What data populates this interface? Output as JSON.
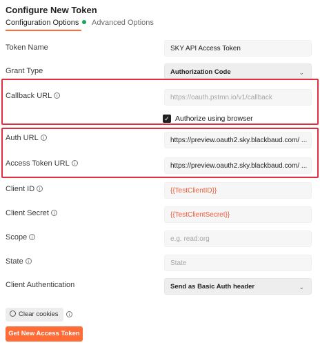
{
  "header": {
    "title": "Configure New Token"
  },
  "tabs": [
    {
      "label": "Configuration Options",
      "active": true,
      "status": "configured"
    },
    {
      "label": "Advanced Options",
      "active": false
    }
  ],
  "fields": {
    "token_name": {
      "label": "Token Name",
      "value": "SKY API Access Token"
    },
    "grant_type": {
      "label": "Grant Type",
      "value": "Authorization Code"
    },
    "callback_url": {
      "label": "Callback URL",
      "placeholder": "https://oauth.pstmn.io/v1/callback"
    },
    "authorize_browser": {
      "label": "Authorize using browser",
      "checked": true
    },
    "auth_url": {
      "label": "Auth URL",
      "value": "https://preview.oauth2.sky.blackbaud.com/ ..."
    },
    "access_token_url": {
      "label": "Access Token URL",
      "value": "https://preview.oauth2.sky.blackbaud.com/ ..."
    },
    "client_id": {
      "label": "Client ID",
      "value": "{{TestClientID}}"
    },
    "client_secret": {
      "label": "Client Secret",
      "value": "{{TestClientSecret}}"
    },
    "scope": {
      "label": "Scope",
      "placeholder": "e.g. read:org"
    },
    "state": {
      "label": "State",
      "placeholder": "State"
    },
    "client_auth": {
      "label": "Client Authentication",
      "value": "Send as Basic Auth header"
    }
  },
  "buttons": {
    "clear_cookies": "Clear cookies",
    "get_token": "Get New Access Token"
  },
  "icons": {
    "info": "ⓘ",
    "chevron": "chevron-down-icon",
    "check": "✓"
  },
  "colors": {
    "accent": "#ff6c37",
    "highlight": "#dc2f3f",
    "status_green": "#1aa55c",
    "variable": "#ef5b3a"
  }
}
